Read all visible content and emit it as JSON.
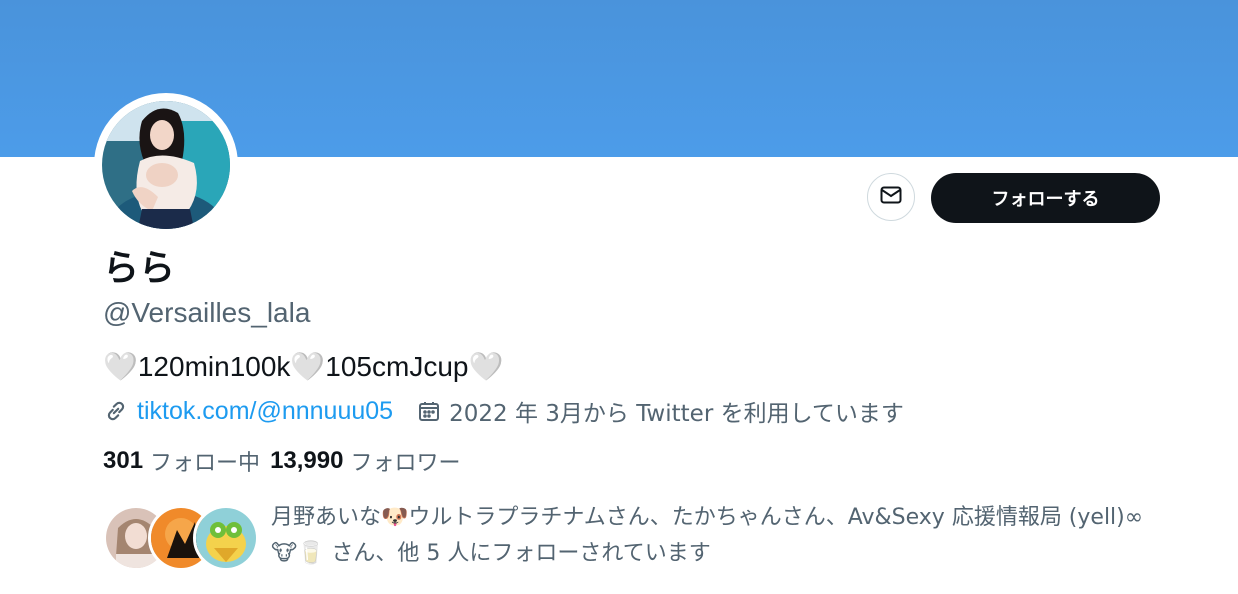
{
  "banner": {
    "color": "#4a93db"
  },
  "profile": {
    "display_name": "らら",
    "handle": "@Versailles_lala",
    "bio": "🤍120min100k🤍105cmJcup🤍",
    "link_text": "tiktok.com/@nnnuuu05",
    "joined_text": "2022 年 3月から Twitter を利用しています"
  },
  "actions": {
    "message_icon": "envelope-icon",
    "follow_label": "フォローする"
  },
  "stats": {
    "following_count": "301",
    "following_label": "フォロー中",
    "followers_count": "13,990",
    "followers_label": "フォロワー"
  },
  "followers_you_know": {
    "text": "月野あいな🐶ウルトラプラチナムさん、たかちゃんさん、Av&Sexy 応援情報局 (yell)∞🐮🥛 さん、他 5 人にフォローされています"
  },
  "colors": {
    "accent": "#1d9bf0",
    "follow_button_bg": "#0f1419",
    "secondary_text": "#536471"
  }
}
